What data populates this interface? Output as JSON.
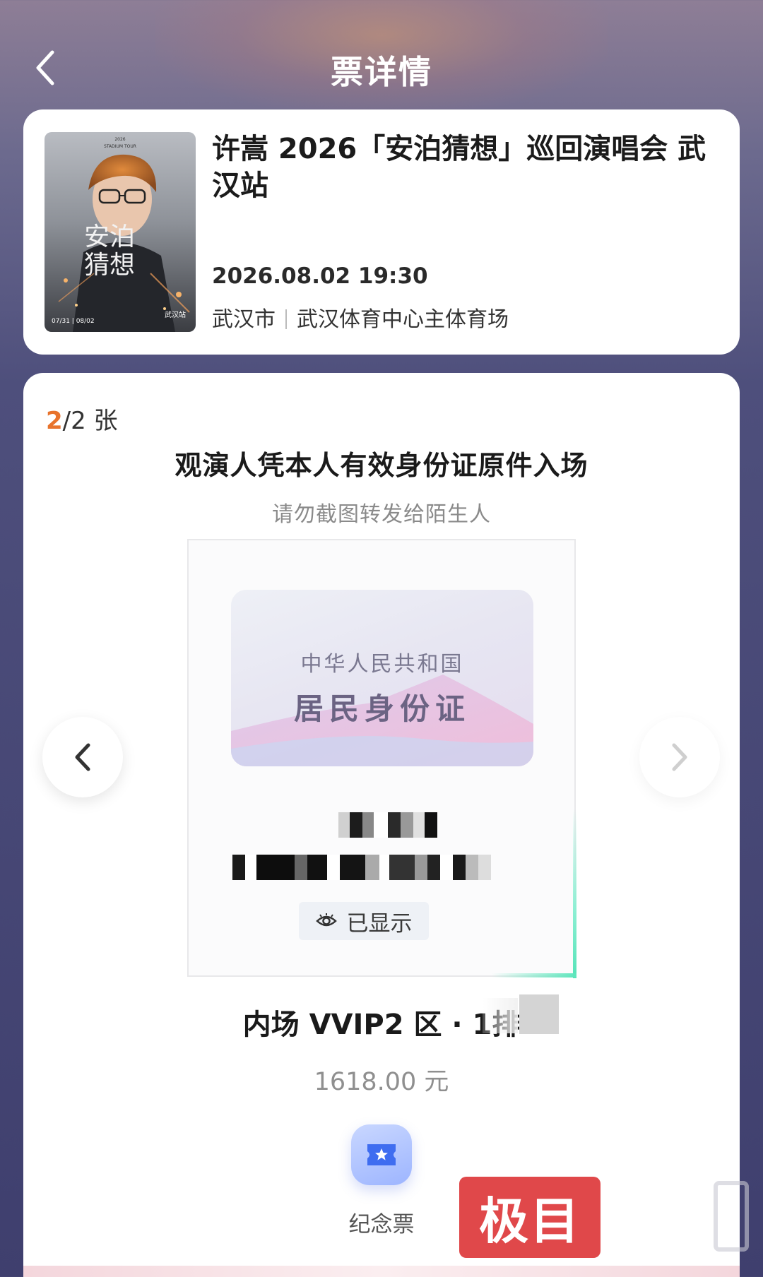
{
  "header": {
    "title": "票详情",
    "back_icon": "chevron-left-icon"
  },
  "event": {
    "title": "许嵩 2026「安泊猜想」巡回演唱会 武汉站",
    "datetime": "2026.08.02 19:30",
    "city": "武汉市",
    "venue": "武汉体育中心主体育场",
    "poster": {
      "tour_label": "STADIUM TOUR",
      "year": "2026",
      "title_line1": "安泊",
      "title_line2": "猜想",
      "dates": "07/31 | 08/02",
      "station": "武汉站"
    }
  },
  "ticket": {
    "current_index": "2",
    "count_suffix": "/2 张",
    "entry_note": "观演人凭本人有效身份证原件入场",
    "warning": "请勿截图转发给陌生人",
    "id_country": "中华人民共和国",
    "id_type": "居民身份证",
    "shown_label": "已显示",
    "seat": "内场 VVIP2 区 · 1排",
    "price": "1618.00 元",
    "souvenir_label": "纪念票"
  },
  "watermark": {
    "text": "极目"
  },
  "colors": {
    "accent": "#e8732c",
    "watermark": "#e0484a",
    "scan_line": "#55e3b8"
  }
}
